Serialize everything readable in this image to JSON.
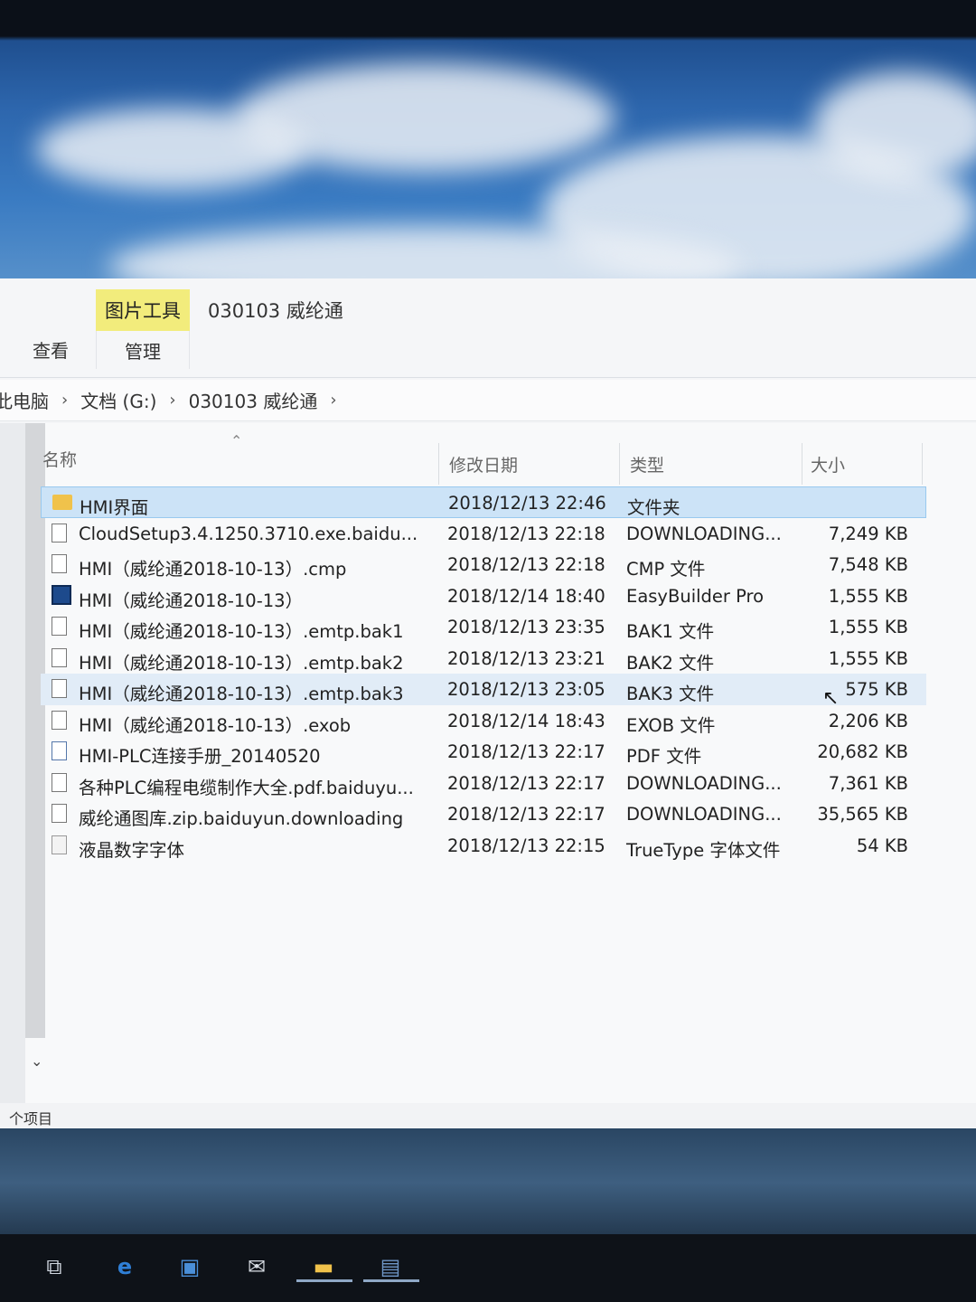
{
  "ribbon": {
    "tool_tab": "图片工具",
    "window_title": "030103 威纶通",
    "view_tab": "查看",
    "manage_tab": "管理"
  },
  "address": {
    "crumbs": [
      "此电脑",
      "文档 (G:)",
      "030103 威纶通"
    ],
    "separator": "›"
  },
  "columns": {
    "name": "名称",
    "date": "修改日期",
    "type": "类型",
    "size": "大小"
  },
  "files": [
    {
      "name": "HMI界面",
      "date": "2018/12/13 22:46",
      "type": "文件夹",
      "size": "",
      "icon": "folder-icon"
    },
    {
      "name": "CloudSetup3.4.1250.3710.exe.baidu...",
      "date": "2018/12/13 22:18",
      "type": "DOWNLOADING...",
      "size": "7,249 KB",
      "icon": "file-icon"
    },
    {
      "name": "HMI（威纶通2018-10-13）.cmp",
      "date": "2018/12/13 22:18",
      "type": "CMP 文件",
      "size": "7,548 KB",
      "icon": "file-icon"
    },
    {
      "name": "HMI（威纶通2018-10-13）",
      "date": "2018/12/14 18:40",
      "type": "EasyBuilder Pro",
      "size": "1,555 KB",
      "icon": "app-icon"
    },
    {
      "name": "HMI（威纶通2018-10-13）.emtp.bak1",
      "date": "2018/12/13 23:35",
      "type": "BAK1 文件",
      "size": "1,555 KB",
      "icon": "file-icon"
    },
    {
      "name": "HMI（威纶通2018-10-13）.emtp.bak2",
      "date": "2018/12/13 23:21",
      "type": "BAK2 文件",
      "size": "1,555 KB",
      "icon": "file-icon"
    },
    {
      "name": "HMI（威纶通2018-10-13）.emtp.bak3",
      "date": "2018/12/13 23:05",
      "type": "BAK3 文件",
      "size": "575 KB",
      "icon": "file-icon"
    },
    {
      "name": "HMI（威纶通2018-10-13）.exob",
      "date": "2018/12/14 18:43",
      "type": "EXOB 文件",
      "size": "2,206 KB",
      "icon": "file-icon"
    },
    {
      "name": "HMI-PLC连接手册_20140520",
      "date": "2018/12/13 22:17",
      "type": "PDF 文件",
      "size": "20,682 KB",
      "icon": "pdf-icon"
    },
    {
      "name": "各种PLC编程电缆制作大全.pdf.baiduyu...",
      "date": "2018/12/13 22:17",
      "type": "DOWNLOADING...",
      "size": "7,361 KB",
      "icon": "file-icon"
    },
    {
      "name": "威纶通图库.zip.baiduyun.downloading",
      "date": "2018/12/13 22:17",
      "type": "DOWNLOADING...",
      "size": "35,565 KB",
      "icon": "file-icon"
    },
    {
      "name": "液晶数字字体",
      "date": "2018/12/13 22:15",
      "type": "TrueType 字体文件",
      "size": "54 KB",
      "icon": "font-icon"
    }
  ],
  "status": {
    "items_label": "个项目"
  },
  "colors": {
    "tool_tab": "#f2ec7c",
    "selected_row": "#cce3f7",
    "hover_row": "#e1ecf7"
  }
}
